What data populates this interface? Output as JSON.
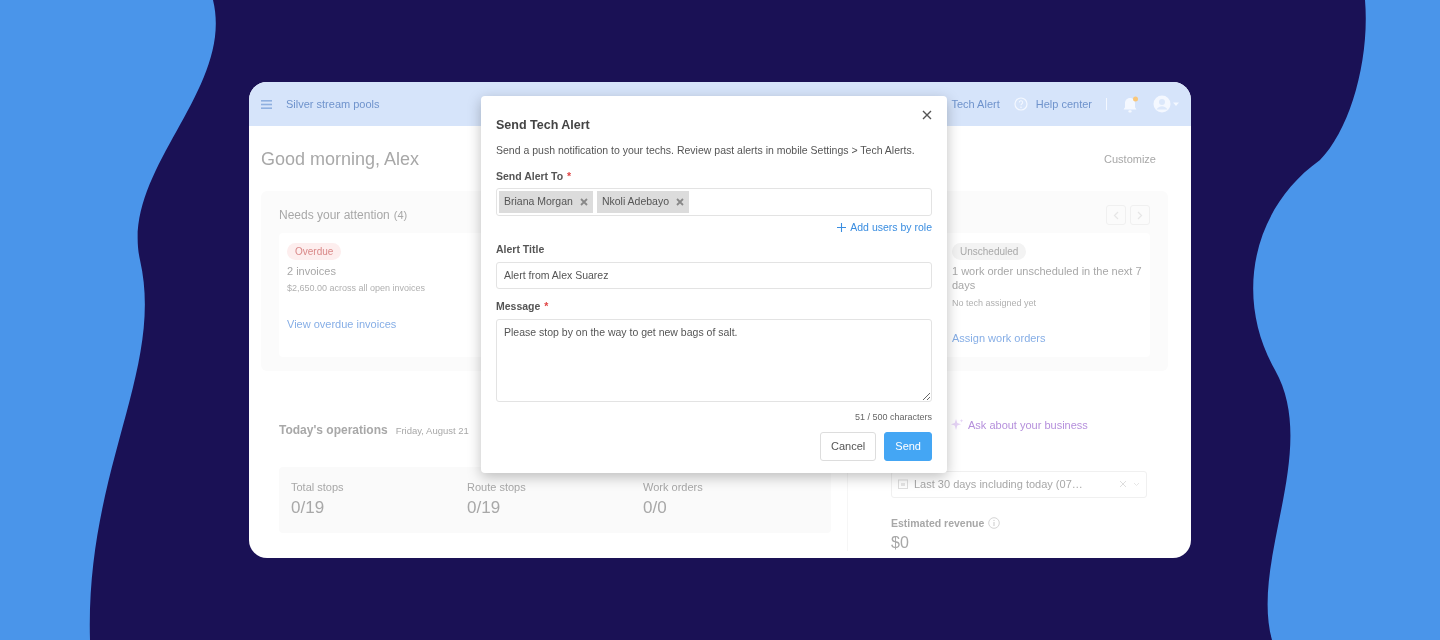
{
  "topbar": {
    "company": "Silver stream pools",
    "partial_action": "Tech Alert",
    "help": "Help center",
    "notification_dot": true
  },
  "greeting": "Good morning, Alex",
  "customize": "Customize",
  "attention": {
    "title": "Needs your attention",
    "count": "(4)",
    "cards": [
      {
        "kind": "overdue",
        "badge": "Overdue",
        "headline": "2 invoices",
        "detail": "$2,650.00 across all open invoices",
        "link": "View overdue invoices"
      },
      {
        "kind": "unscheduled",
        "badge": "Unscheduled",
        "headline": "1 work order unscheduled in the next 7 days",
        "detail": "No tech assigned yet",
        "link": "Assign work orders"
      }
    ]
  },
  "operations": {
    "title": "Today's operations",
    "date": "Friday, August 21",
    "stats": [
      {
        "label": "Total stops",
        "value": "0/19"
      },
      {
        "label": "Route stops",
        "value": "0/19"
      },
      {
        "label": "Work orders",
        "value": "0/0"
      }
    ]
  },
  "assistant": {
    "label": "Ask about your business"
  },
  "date_filter": {
    "value": "Last 30 days including today (07…"
  },
  "metric": {
    "label": "Estimated revenue",
    "value": "$0"
  },
  "modal": {
    "title": "Send Tech Alert",
    "description": "Send a push notification to your techs. Review past alerts in mobile Settings > Tech Alerts.",
    "fields": [
      {
        "kind": "tags",
        "label": "Send Alert To",
        "required_mark": "*",
        "tags": [
          "Briana Morgan",
          "Nkoli Adebayo"
        ],
        "action": "Add users by role"
      },
      {
        "kind": "input",
        "label": "Alert Title",
        "value": "Alert from Alex Suarez"
      },
      {
        "kind": "textarea",
        "label": "Message",
        "required_mark": "*",
        "value": "Please stop by on the way to get new bags of salt.",
        "counter": "51 / 500 characters"
      }
    ],
    "buttons": [
      {
        "kind": "secondary",
        "label": "Cancel"
      },
      {
        "kind": "primary",
        "label": "Send"
      }
    ]
  }
}
